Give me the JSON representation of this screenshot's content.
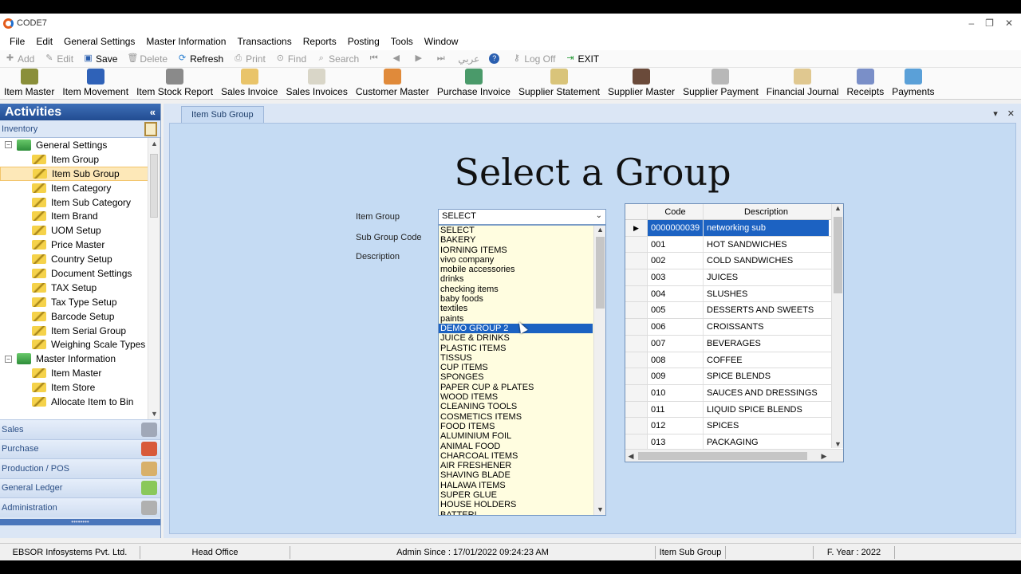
{
  "app": {
    "title": "CODE7",
    "window_controls": [
      "–",
      "❐",
      "✕"
    ]
  },
  "menu": [
    "File",
    "Edit",
    "General Settings",
    "Master Information",
    "Transactions",
    "Reports",
    "Posting",
    "Tools",
    "Window"
  ],
  "toolbar": {
    "add": "Add",
    "edit": "Edit",
    "save": "Save",
    "delete": "Delete",
    "refresh": "Refresh",
    "print": "Print",
    "find": "Find",
    "search": "Search",
    "arabic": "عربي",
    "logoff": "Log Off",
    "exit": "EXIT"
  },
  "quickbar": [
    {
      "label": "Item Master",
      "color": "#8a8f3a"
    },
    {
      "label": "Item Movement",
      "color": "#2f62b8"
    },
    {
      "label": "Item Stock Report",
      "color": "#8a8a8a"
    },
    {
      "label": "Sales Invoice",
      "color": "#e9c46a"
    },
    {
      "label": "Sales Invoices",
      "color": "#d9d6c8"
    },
    {
      "label": "Customer Master",
      "color": "#e08a3a"
    },
    {
      "label": "Purchase Invoice",
      "color": "#4a9a6a"
    },
    {
      "label": "Supplier Statement",
      "color": "#d9c47a"
    },
    {
      "label": "Supplier Master",
      "color": "#6a4a3a"
    },
    {
      "label": "Supplier Payment",
      "color": "#b8b8b8"
    },
    {
      "label": "Financial Journal",
      "color": "#e0c890"
    },
    {
      "label": "Receipts",
      "color": "#7a8fc8"
    },
    {
      "label": "Payments",
      "color": "#5aa0d8"
    }
  ],
  "sidebar": {
    "title": "Activities",
    "collapse": "«",
    "section_inventory": "Inventory",
    "tree": [
      {
        "label": "General Settings",
        "level": 0,
        "expanded": true
      },
      {
        "label": "Item Group",
        "level": 1
      },
      {
        "label": "Item Sub Group",
        "level": 1,
        "selected": true
      },
      {
        "label": "Item Category",
        "level": 1
      },
      {
        "label": "Item Sub Category",
        "level": 1
      },
      {
        "label": "Item Brand",
        "level": 1
      },
      {
        "label": "UOM Setup",
        "level": 1
      },
      {
        "label": "Price Master",
        "level": 1
      },
      {
        "label": "Country Setup",
        "level": 1
      },
      {
        "label": "Document Settings",
        "level": 1
      },
      {
        "label": "TAX Setup",
        "level": 1
      },
      {
        "label": "Tax Type Setup",
        "level": 1
      },
      {
        "label": "Barcode Setup",
        "level": 1
      },
      {
        "label": "Item Serial Group",
        "level": 1
      },
      {
        "label": "Weighing Scale Types",
        "level": 1
      },
      {
        "label": "Master Information",
        "level": 0,
        "expanded": true
      },
      {
        "label": "Item Master",
        "level": 1
      },
      {
        "label": "Item Store",
        "level": 1
      },
      {
        "label": "Allocate Item to Bin",
        "level": 1
      }
    ],
    "sections": [
      {
        "label": "Sales",
        "color": "#a0a8b8"
      },
      {
        "label": "Purchase",
        "color": "#d85a3a"
      },
      {
        "label": "Production / POS",
        "color": "#d8b06a"
      },
      {
        "label": "General Ledger",
        "color": "#8ac85a"
      },
      {
        "label": "Administration",
        "color": "#b0b0b0"
      }
    ],
    "grip": "••••••••"
  },
  "tab": {
    "label": "Item Sub Group",
    "pin": "▾",
    "close": "✕"
  },
  "form": {
    "heading": "Select a Group",
    "item_group_label": "Item Group",
    "sub_group_code_label": "Sub Group Code",
    "description_label": "Description",
    "selected_group": "SELECT"
  },
  "dropdown_items": [
    "SELECT",
    "BAKERY",
    "IORNING ITEMS",
    "vivo company",
    "mobile accessories",
    "drinks",
    "checking items",
    "baby foods",
    "textiles",
    "paints",
    "DEMO GROUP 2",
    "JUICE & DRINKS",
    "PLASTIC ITEMS",
    "TISSUS",
    "CUP ITEMS",
    "SPONGES",
    "PAPER CUP & PLATES",
    "WOOD ITEMS",
    "CLEANING TOOLS",
    "COSMETICS ITEMS",
    "FOOD ITEMS",
    "ALUMINIUM FOIL",
    "ANIMAL FOOD",
    "CHARCOAL ITEMS",
    "AIR FRESHENER",
    "SHAVING BLADE",
    "HALAWA ITEMS",
    "SUPER GLUE",
    "HOUSE HOLDERS",
    "BATTERI"
  ],
  "dropdown_highlight": "DEMO GROUP 2",
  "grid": {
    "columns": [
      "Code",
      "Description"
    ],
    "row_marker": "▶",
    "rows": [
      {
        "code": "0000000039",
        "desc": "networking sub",
        "selected": true
      },
      {
        "code": "001",
        "desc": "HOT SANDWICHES"
      },
      {
        "code": "002",
        "desc": "COLD SANDWICHES"
      },
      {
        "code": "003",
        "desc": "JUICES"
      },
      {
        "code": "004",
        "desc": "SLUSHES"
      },
      {
        "code": "005",
        "desc": "DESSERTS AND SWEETS"
      },
      {
        "code": "006",
        "desc": "CROISSANTS"
      },
      {
        "code": "007",
        "desc": "BEVERAGES"
      },
      {
        "code": "008",
        "desc": "COFFEE"
      },
      {
        "code": "009",
        "desc": "SPICE BLENDS"
      },
      {
        "code": "010",
        "desc": "SAUCES AND DRESSINGS"
      },
      {
        "code": "011",
        "desc": "LIQUID SPICE BLENDS"
      },
      {
        "code": "012",
        "desc": "SPICES"
      },
      {
        "code": "013",
        "desc": "PACKAGING"
      }
    ]
  },
  "status": {
    "company": "EBSOR Infosystems Pvt. Ltd.",
    "branch": "Head Office",
    "admin_since": "Admin Since : 17/01/2022 09:24:23 AM",
    "screen": "Item Sub Group",
    "fyear": "F. Year : 2022"
  }
}
